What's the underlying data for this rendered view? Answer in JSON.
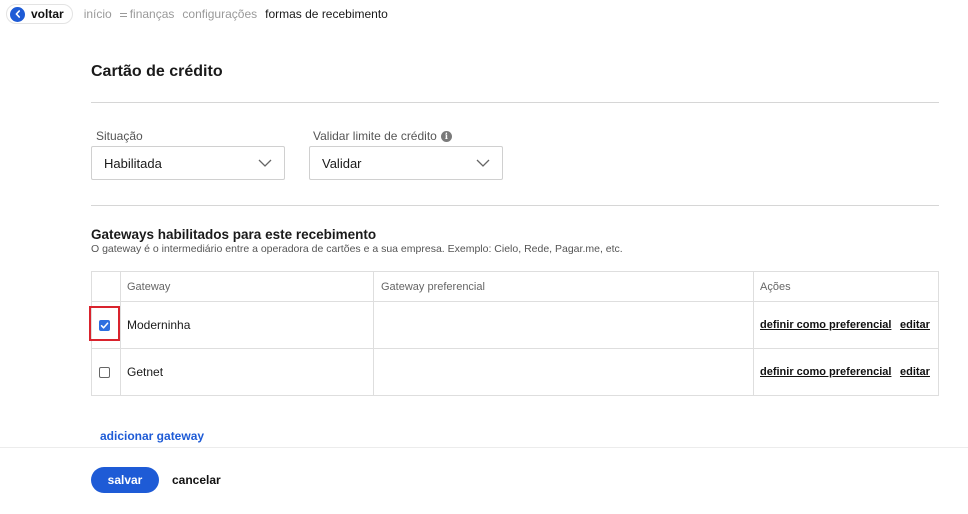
{
  "nav": {
    "back_label": "voltar",
    "breadcrumbs": [
      "início",
      "finanças",
      "configurações",
      "formas de recebimento"
    ]
  },
  "page": {
    "title": "Cartão de crédito"
  },
  "form": {
    "situacao": {
      "label": "Situação",
      "value": "Habilitada"
    },
    "validar": {
      "label": "Validar limite de crédito",
      "value": "Validar"
    }
  },
  "gateways": {
    "title": "Gateways habilitados para este recebimento",
    "description": "O gateway é o intermediário entre a operadora de cartões e a sua empresa. Exemplo: Cielo, Rede, Pagar.me, etc.",
    "columns": [
      "Gateway",
      "Gateway preferencial",
      "Ações"
    ],
    "rows": [
      {
        "name": "Moderninha",
        "checked": true,
        "preferred": "",
        "action_prefer": "definir como preferencial",
        "action_edit": "editar"
      },
      {
        "name": "Getnet",
        "checked": false,
        "preferred": "",
        "action_prefer": "definir como preferencial",
        "action_edit": "editar"
      }
    ],
    "add_label": "adicionar gateway"
  },
  "footer": {
    "save_label": "salvar",
    "cancel_label": "cancelar"
  },
  "colors": {
    "primary": "#1e5bd6",
    "highlight": "#d9232d",
    "checkbox": "#2d6fe0"
  }
}
